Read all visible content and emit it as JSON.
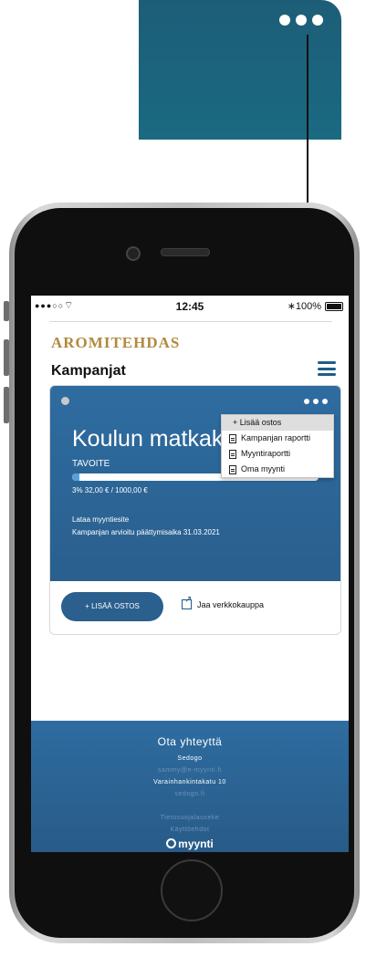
{
  "colors": {
    "primary": "#2a5f8e",
    "brand_gold": "#b08a3e",
    "callout": "#1d5d78"
  },
  "status_bar": {
    "signal": "●●●○○",
    "wifi": "⌔",
    "time": "12:45",
    "bluetooth": "∗",
    "battery": "100%"
  },
  "header": {
    "brand": "AROMITEHDAS",
    "title": "Kampanjat",
    "menu_icon": "hamburger-icon"
  },
  "campaign": {
    "title": "Koulun matkaka",
    "goal_label": "TAVOITE",
    "progress_percent": 3,
    "progress_text": "3%   32,00 € / 1000,00 €",
    "download_link": "Lataa myyntiesite",
    "end_date_text": "Kampanjan arvioitu päättymisaika 31.03.2021"
  },
  "menu": {
    "items": [
      {
        "label": "+ Lisää ostos"
      },
      {
        "label": "Kampanjan raportti"
      },
      {
        "label": "Myyntiraportti"
      },
      {
        "label": "Oma myynti"
      }
    ]
  },
  "actions": {
    "add_purchase": "+ LISÄÄ OSTOS",
    "share": "Jaa verkkokauppa"
  },
  "footer": {
    "heading": "Ota yhteyttä",
    "company": "Sedogo",
    "email": "sammy@e-myynti.fi",
    "address": "Varainhankintakatu 10",
    "website": "sedogo.fi",
    "privacy": "Tietosuojalauseke",
    "terms": "Käyttöehdot",
    "logo": "myynti"
  }
}
